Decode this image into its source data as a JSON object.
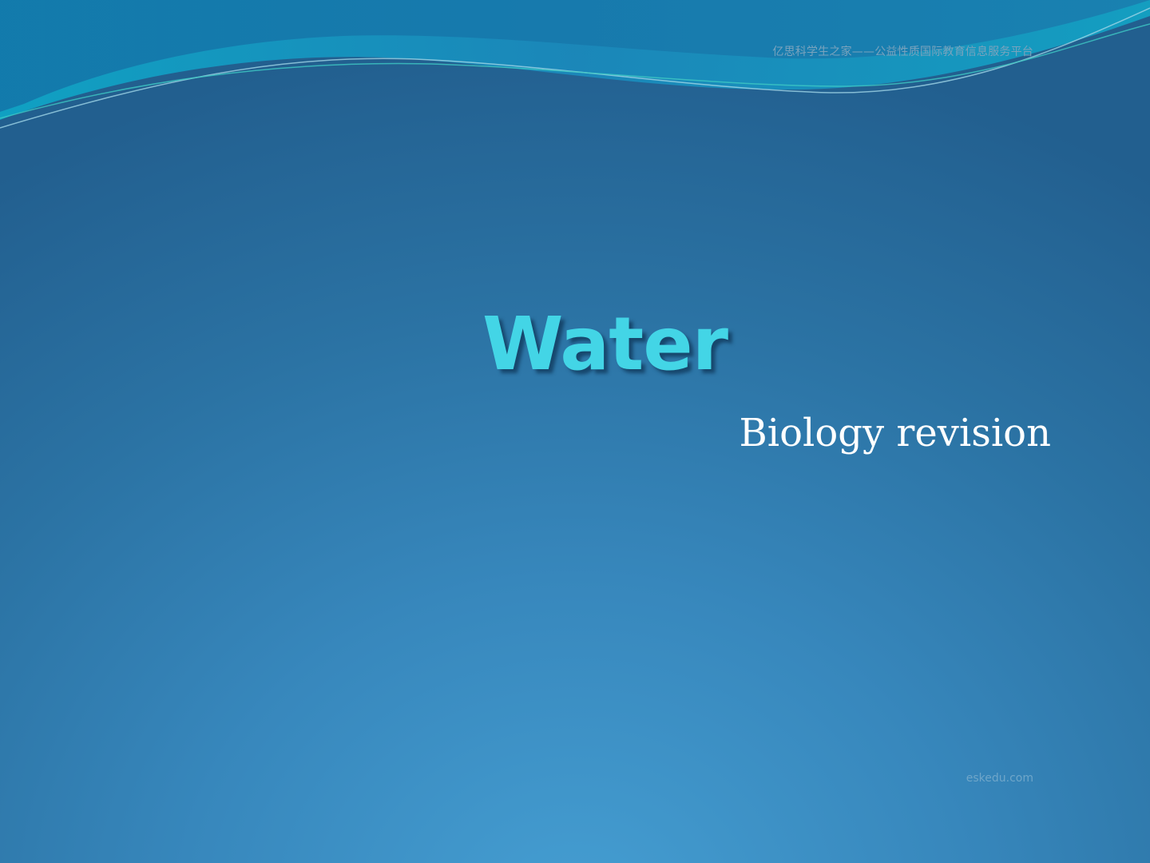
{
  "slide": {
    "header_text": "亿思科学生之家——公益性质国际教育信息服务平台",
    "title": "Water",
    "subtitle": "Biology revision",
    "footer_text": "eskedu.com"
  },
  "colors": {
    "background_center": "#459ed2",
    "background_edge": "#225f8f",
    "title": "#43d5e6",
    "subtitle": "#ffffff",
    "wave_light": "#12a2c6",
    "wave_dark": "#1470a4"
  }
}
